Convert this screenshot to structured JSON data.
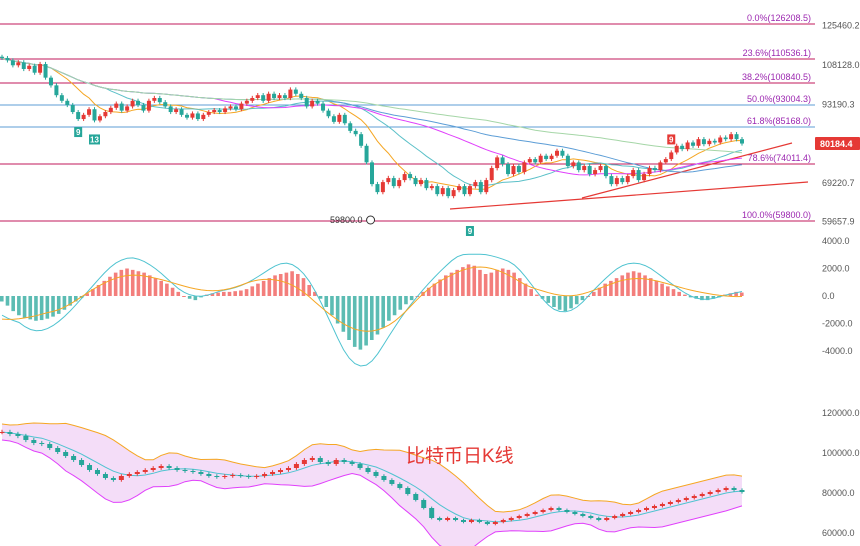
{
  "chart_data": {
    "type": "candlestick",
    "title": "比特币日K线",
    "current_price": "80184.4",
    "colors": {
      "up": "#e53935",
      "down": "#26a69a",
      "fib_line_pink": "#c2185b",
      "fib_line_blue": "#5c9dd6",
      "fib_text": "#9c27b0",
      "trend": "#e53935",
      "price_tag": "#e53935",
      "bb_fill": "#f3d9f7"
    },
    "fib_levels": [
      {
        "label": "0.0%(126208.5)",
        "price": 126208.5,
        "line": "pink"
      },
      {
        "label": "23.6%(110536.1)",
        "price": 110536.1,
        "line": "pink"
      },
      {
        "label": "38.2%(100840.5)",
        "price": 100840.5,
        "line": "pink"
      },
      {
        "label": "50.0%(93004.3)",
        "price": 93004.3,
        "line": "blue"
      },
      {
        "label": "61.8%(85168.0)",
        "price": 85168.0,
        "line": "blue"
      },
      {
        "label": "78.6%(74011.4)",
        "price": 74011.4,
        "line": "pink"
      },
      {
        "label": "100.0%(59800.0)",
        "price": 59800.0,
        "line": "pink"
      }
    ],
    "price_axis_ticks": [
      "125460.2",
      "108128.0",
      "93190.3",
      "69220.7",
      "59657.9"
    ],
    "price_axis_values": [
      125460.2,
      108128.0,
      93190.3,
      69220.7,
      59657.9
    ],
    "macd_axis_ticks": [
      "4000.0",
      "2000.0",
      "0.0",
      "-2000.0",
      "-4000.0"
    ],
    "macd_axis_values": [
      4000,
      2000,
      0,
      -2000,
      -4000
    ],
    "boll_axis_ticks": [
      "120000.0",
      "100000.0",
      "80000.0",
      "60000.0"
    ],
    "boll_axis_values": [
      120000,
      100000,
      80000,
      60000
    ],
    "low_annotation": "59800.0",
    "markers": [
      {
        "label": "9",
        "index": 14,
        "kind": "down"
      },
      {
        "label": "13",
        "index": 17,
        "kind": "down"
      },
      {
        "label": "9",
        "index": 123,
        "kind": "up"
      },
      {
        "label": "9",
        "index": 86,
        "kind": "down"
      }
    ],
    "closes": [
      111000,
      110000,
      108000,
      109200,
      106500,
      107800,
      105000,
      108500,
      103000,
      100000,
      96500,
      94500,
      93000,
      90500,
      88000,
      89500,
      91500,
      87500,
      89000,
      90500,
      92000,
      93500,
      91000,
      92500,
      94500,
      93000,
      91000,
      94500,
      95500,
      94000,
      92500,
      90500,
      91500,
      89500,
      88500,
      90000,
      88000,
      89500,
      90500,
      91200,
      90500,
      91800,
      92500,
      91500,
      93500,
      94500,
      95500,
      96500,
      94500,
      97000,
      95500,
      96500,
      95500,
      98500,
      97000,
      95500,
      92500,
      94500,
      93500,
      91000,
      89000,
      87000,
      89500,
      86500,
      84000,
      83000,
      79500,
      74500,
      69000,
      67000,
      69500,
      70500,
      68500,
      70000,
      71500,
      70500,
      69000,
      70000,
      68000,
      68500,
      66500,
      68000,
      66000,
      67500,
      68500,
      66500,
      68500,
      69500,
      67000,
      70000,
      73000,
      76000,
      74000,
      71500,
      73500,
      72000,
      74500,
      75500,
      74500,
      76500,
      75500,
      76500,
      78000,
      76500,
      73500,
      74500,
      72500,
      73500,
      71500,
      72500,
      73500,
      71000,
      69000,
      70500,
      69500,
      71000,
      72500,
      70000,
      71500,
      73000,
      72500,
      74500,
      75500,
      77500,
      79500,
      78500,
      80500,
      79500,
      81500,
      80000,
      81000,
      80500,
      82000,
      81500,
      83000,
      81500,
      80184.4
    ],
    "macd_hist": [
      -400,
      -700,
      -1100,
      -1400,
      -1600,
      -1700,
      -1800,
      -1750,
      -1650,
      -1500,
      -1300,
      -1000,
      -700,
      -400,
      -150,
      200,
      500,
      800,
      1100,
      1400,
      1700,
      1900,
      2000,
      1900,
      1800,
      1700,
      1500,
      1300,
      1100,
      900,
      600,
      300,
      0,
      -200,
      -300,
      -100,
      100,
      200,
      250,
      300,
      300,
      350,
      400,
      500,
      700,
      900,
      1100,
      1300,
      1500,
      1600,
      1700,
      1800,
      1600,
      1300,
      800,
      300,
      -200,
      -800,
      -1400,
      -2000,
      -2600,
      -3200,
      -3700,
      -3900,
      -3600,
      -3200,
      -2800,
      -2300,
      -1800,
      -1400,
      -1000,
      -600,
      -300,
      0,
      300,
      600,
      900,
      1200,
      1500,
      1700,
      1900,
      2100,
      2300,
      2200,
      1900,
      1600,
      1700,
      1900,
      2000,
      1900,
      1700,
      1300,
      900,
      500,
      100,
      -200,
      -500,
      -800,
      -1000,
      -1100,
      -900,
      -600,
      -300,
      0,
      300,
      600,
      900,
      1100,
      1300,
      1500,
      1700,
      1800,
      1700,
      1500,
      1300,
      1100,
      900,
      700,
      500,
      300,
      100,
      -100,
      -200,
      -300,
      -300,
      -200,
      -100,
      100,
      200,
      300,
      250
    ],
    "boll_closes": [
      110500,
      109500,
      108500,
      106500,
      105000,
      104500,
      102500,
      100500,
      98500,
      96500,
      94000,
      91500,
      89500,
      87500,
      86500,
      88500,
      89500,
      90500,
      91500,
      92500,
      93500,
      92500,
      91500,
      91000,
      90500,
      89500,
      88500,
      88000,
      88500,
      89000,
      88500,
      88000,
      88500,
      89500,
      90500,
      91500,
      92500,
      94500,
      96500,
      97500,
      95500,
      94500,
      96500,
      95500,
      94500,
      92500,
      90500,
      88500,
      86500,
      84500,
      82500,
      79500,
      76500,
      72500,
      67500,
      66500,
      67500,
      66500,
      65500,
      66500,
      65500,
      64500,
      65500,
      66500,
      67500,
      68500,
      69500,
      70500,
      71500,
      72500,
      71500,
      70500,
      69500,
      68500,
      67500,
      66500,
      67500,
      68500,
      69500,
      70500,
      71500,
      72500,
      73500,
      74500,
      75500,
      76500,
      77500,
      78500,
      79500,
      80500,
      81500,
      82500,
      81500,
      80500
    ]
  }
}
